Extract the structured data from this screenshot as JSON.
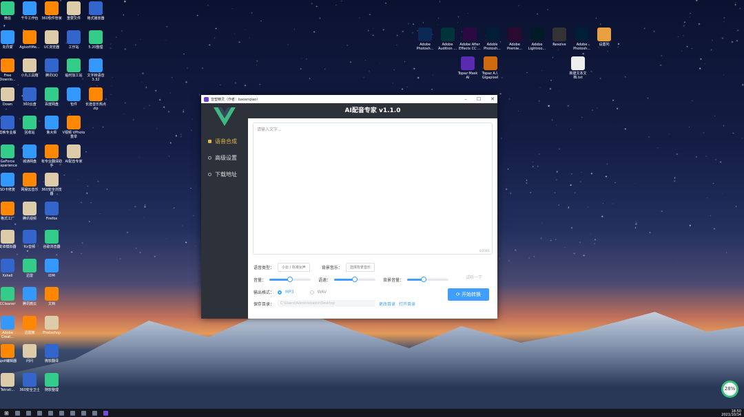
{
  "desktop": {
    "left_columns": [
      [
        "微信",
        "向日葵",
        "Free Downlo...",
        "Down",
        "剪映专业版",
        "GeForce Experience",
        "SD卡修复",
        "格式工厂",
        "安卓模拟器",
        "Xshell",
        "CCleaner",
        "Adobe Creat...",
        "Spdf编辑器",
        "Tetrati..."
      ],
      [
        "千牛工作台",
        "AgisoftMe...",
        "小丸工具箱",
        "360云盘",
        "回收站",
        "城通网盘",
        "网易云音乐",
        "腾讯视频",
        "Kx音频",
        "迅雷",
        "腾讯微云",
        "迅雷精",
        "问问",
        "360安全卫士"
      ],
      [
        "360软件管家",
        "UC浏览器",
        "腾讯QQ",
        "百度网盘",
        "鲁大师",
        "有专业翻译助手",
        "360安全浏览器",
        "Firefox",
        "谷歌浏览器",
        "IDM",
        "文档",
        "Photoshop",
        "微软翻译",
        "随软整理"
      ],
      [
        "重要文件",
        "工作站",
        "临时加工站",
        "包件",
        "V视频 VPhoto重举",
        "AI配音专家",
        "",
        "",
        "",
        "",
        "",
        "",
        "",
        ""
      ],
      [
        "格式播放器",
        "5.20整理",
        "文字转语音3.32",
        "长途音乐热点zip",
        "",
        "",
        "",
        "",
        "",
        "",
        "",
        "",
        "",
        ""
      ]
    ],
    "right_icons": [
      "Adobe Photosh...",
      "Adobe Audition ...",
      "Adobe After Effects CC ...",
      "Adobe Photosh...",
      "Adobe Premie...",
      "Adobe Lightroo...",
      "Resolve",
      "Adobe Photosh...",
      "设置列",
      "Topaz Mask AI",
      "Topaz A.I. Gigapixel",
      "新建文本文档.txt"
    ]
  },
  "window": {
    "title": "音塑精灵（作者：baoanqiao）",
    "controls": [
      "–",
      "☐",
      "✕"
    ],
    "header": "AI配音专家 v1.1.0",
    "nav": [
      {
        "label": "语音合成",
        "active": true
      },
      {
        "label": "高级设置"
      },
      {
        "label": "下载地址"
      }
    ],
    "text_placeholder": "请输入文字...",
    "counter": "0/2000",
    "voice_label": "语音类型：",
    "voice_value": "小云 / 标准女声",
    "bgm_label": "背景音乐：",
    "bgm_value": "选择背景音乐",
    "volume_label": "音量：",
    "volume": 50,
    "speed_label": "语速：",
    "speed": 50,
    "bg_volume_label": "背景音量：",
    "bg_volume": 40,
    "listen": "试听一下",
    "format_label": "输出格式：",
    "formats": [
      "MP3",
      "WAV"
    ],
    "format_selected": "MP3",
    "save_label": "保存目录：",
    "save_path": "C:\\Users\\Administrator\\Desktop",
    "change_dir": "更改目录",
    "open_dir": "打开目录",
    "start": "⟳ 开始转换",
    "accent": "#409eff"
  },
  "system": {
    "cpu_gauge": "28%",
    "time": "18:50",
    "date": "2021/10/14"
  }
}
